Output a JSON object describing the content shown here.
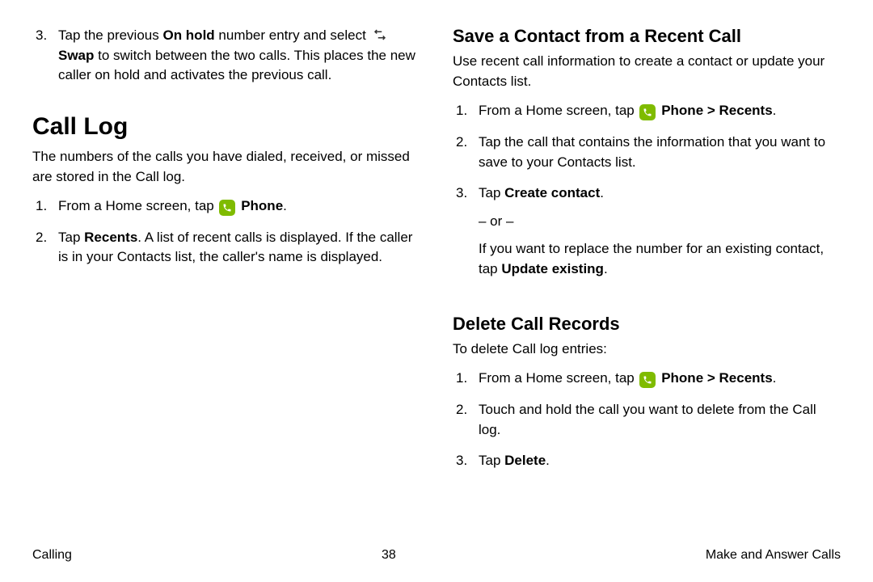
{
  "left": {
    "item3_a": "Tap the previous ",
    "item3_bold1": "On hold",
    "item3_b": " number entry and select ",
    "item3_swap": "Swap",
    "item3_c": " to switch between the two calls. This places the new caller on hold and activates the previous call.",
    "h1": "Call Log",
    "intro": "The numbers of the calls you have dialed, received, or missed are stored in the Call log.",
    "log1_a": "From a Home screen, tap ",
    "log1_phone": "Phone",
    "log1_b": ".",
    "log2_a": "Tap ",
    "log2_recents": "Recents",
    "log2_b": ". A list of recent calls is displayed. If the caller is in your Contacts list, the caller's name is displayed."
  },
  "right": {
    "h2a": "Save a Contact from a Recent Call",
    "introA": "Use recent call information to create a contact or update your Contacts list.",
    "save1_a": "From a Home screen, tap ",
    "save1_phone": "Phone",
    "save1_gt": " > ",
    "save1_recents": "Recents",
    "save1_b": ".",
    "save2": "Tap the call that contains the information that you want to save to your Contacts list.",
    "save3_a": "Tap ",
    "save3_create": "Create contact",
    "save3_b": ".",
    "or": "– or –",
    "save3_alt_a": "If you want to replace the number for an existing contact, tap ",
    "save3_alt_bold": "Update existing",
    "save3_alt_b": ".",
    "h2b": "Delete Call Records",
    "introB": "To delete Call log entries:",
    "del1_a": "From a Home screen, tap ",
    "del1_phone": "Phone",
    "del1_gt": " > ",
    "del1_recents": "Recents",
    "del1_b": ".",
    "del2": "Touch and hold the call you want to delete from the Call log.",
    "del3_a": "Tap ",
    "del3_bold": "Delete",
    "del3_b": "."
  },
  "footer": {
    "left": "Calling",
    "center": "38",
    "right": "Make and Answer Calls"
  }
}
